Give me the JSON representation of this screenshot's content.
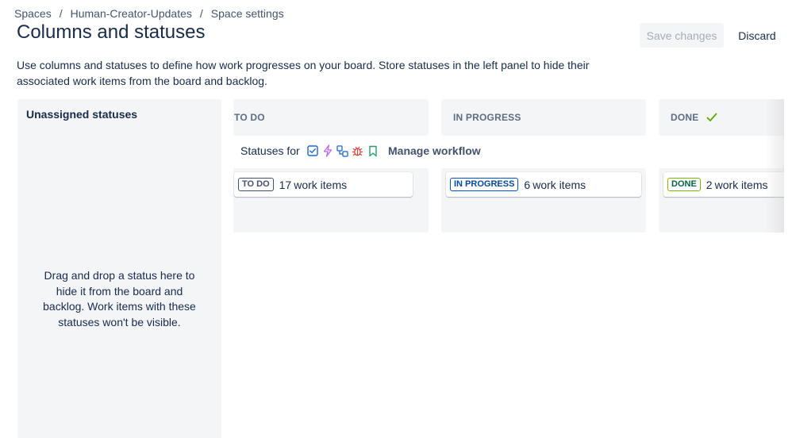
{
  "breadcrumb": {
    "items": [
      "Spaces",
      "Human-Creator-Updates",
      "Space settings"
    ],
    "separator": "/"
  },
  "page": {
    "title": "Columns and statuses",
    "description": "Use columns and statuses to define how work progresses on your board. Store statuses in the left panel to hide their associated work items from the board and backlog."
  },
  "actions": {
    "save_label": "Save changes",
    "discard_label": "Discard"
  },
  "unassigned": {
    "title": "Unassigned statuses",
    "hint": "Drag and drop a status here to hide it from the board and backlog. Work items with these statuses won't be visible."
  },
  "workflow": {
    "statuses_for_label": "Statuses for",
    "issue_type_icons": [
      "task-icon",
      "subtask-lightning-icon",
      "epic-hierarchy-icon",
      "bug-icon",
      "story-bookmark-icon"
    ],
    "manage_label": "Manage workflow"
  },
  "columns": [
    {
      "name": "TO DO",
      "status": "TO DO",
      "count": "17",
      "items_label": "work items",
      "done_check": false
    },
    {
      "name": "IN PROGRESS",
      "status": "IN PROGRESS",
      "count": "6",
      "items_label": "work items",
      "done_check": false
    },
    {
      "name": "DONE",
      "status": "DONE",
      "count": "2",
      "items_label": "work items",
      "done_check": true
    }
  ],
  "colors": {
    "accent_blue": "#0052cc",
    "done_green": "#7fb800",
    "panel_bg": "#f4f5f7",
    "text": "#172b4d"
  }
}
